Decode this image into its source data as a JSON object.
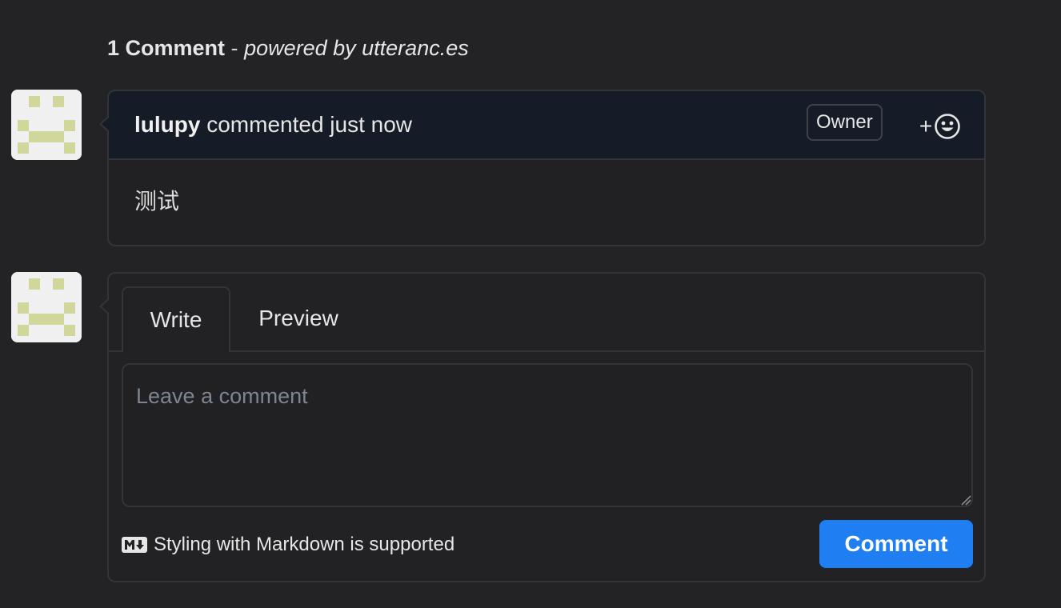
{
  "header": {
    "comment_count": "1 Comment",
    "separator": "-",
    "powered_by": "powered by utteranc.es"
  },
  "comment": {
    "author": "lulupy",
    "action_text": "commented just now",
    "badge": "Owner",
    "reaction_plus": "+",
    "reaction_icon": "smiley-icon",
    "body": "测试"
  },
  "reply": {
    "tabs": [
      {
        "label": "Write",
        "selected": true
      },
      {
        "label": "Preview",
        "selected": false
      }
    ],
    "placeholder": "Leave a comment",
    "value": "",
    "markdown_hint": "Styling with Markdown is supported",
    "markdown_icon": "markdown-icon",
    "submit_label": "Comment"
  },
  "colors": {
    "background": "#232325",
    "comment_header_bg": "#161c27",
    "border": "#33343a",
    "avatar_pattern": "#d1d69a",
    "avatar_bg": "#f0f0f0",
    "primary_button": "#1f7ef1"
  }
}
